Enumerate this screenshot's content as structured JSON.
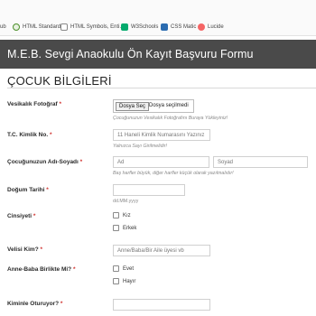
{
  "bookmarks": [
    {
      "label": "ub",
      "icon": "globe-icon"
    },
    {
      "label": "HTML Standard",
      "icon": "globe-icon"
    },
    {
      "label": "HTML Symbols, Enti...",
      "icon": "document-icon"
    },
    {
      "label": "W3Schools",
      "icon": "w3schools-icon"
    },
    {
      "label": "CSS Matic",
      "icon": "css-icon"
    },
    {
      "label": "Lucide",
      "icon": "lucide-icon"
    }
  ],
  "header": {
    "title": "M.E.B. Sevgi Anaokulu Ön Kayıt Başvuru Formu",
    "bg": "#4a4a4a"
  },
  "section": {
    "title": "ÇOCUK BİLGİLERİ"
  },
  "fields": {
    "photo": {
      "label": "Vesikalık Fotoğraf",
      "required": "*",
      "button": "Dosya Seç",
      "status": "Dosya seçilmedi",
      "hint": "Çocuğunuzun Vesikalık Fotoğrafını Buraya Yükleyiniz!"
    },
    "tc": {
      "label": "T.C. Kimlik No.",
      "required": "*",
      "placeholder": "11 Haneli Kimlik Numarasını Yazınız",
      "hint": "Yalnızca Sayı Girilmelidir!"
    },
    "name": {
      "label": "Çocuğunuzun Adı-Soyadı",
      "required": "*",
      "first_placeholder": "Ad",
      "last_placeholder": "Soyad",
      "hint": "Baş harfler büyük, diğer harfler küçük olarak yazılmalıdır!"
    },
    "birth": {
      "label": "Doğum Tarihi",
      "required": "*",
      "hint": "dd.MM.yyyy"
    },
    "gender": {
      "label": "Cinsiyeti",
      "required": "*",
      "options": [
        "Kız",
        "Erkek"
      ]
    },
    "guardian": {
      "label": "Velisi Kim?",
      "required": "*",
      "placeholder": "Anne/Baba/Bir Aile üyesi vb"
    },
    "parents_together": {
      "label": "Anne-Baba Birlikte Mi?",
      "required": "*",
      "options": [
        "Evet",
        "Hayır"
      ]
    },
    "lives_with": {
      "label": "Kiminle Oturuyor?",
      "required": "*"
    }
  },
  "colors": {
    "required": "#d0312d",
    "header": "#4a4a4a"
  }
}
